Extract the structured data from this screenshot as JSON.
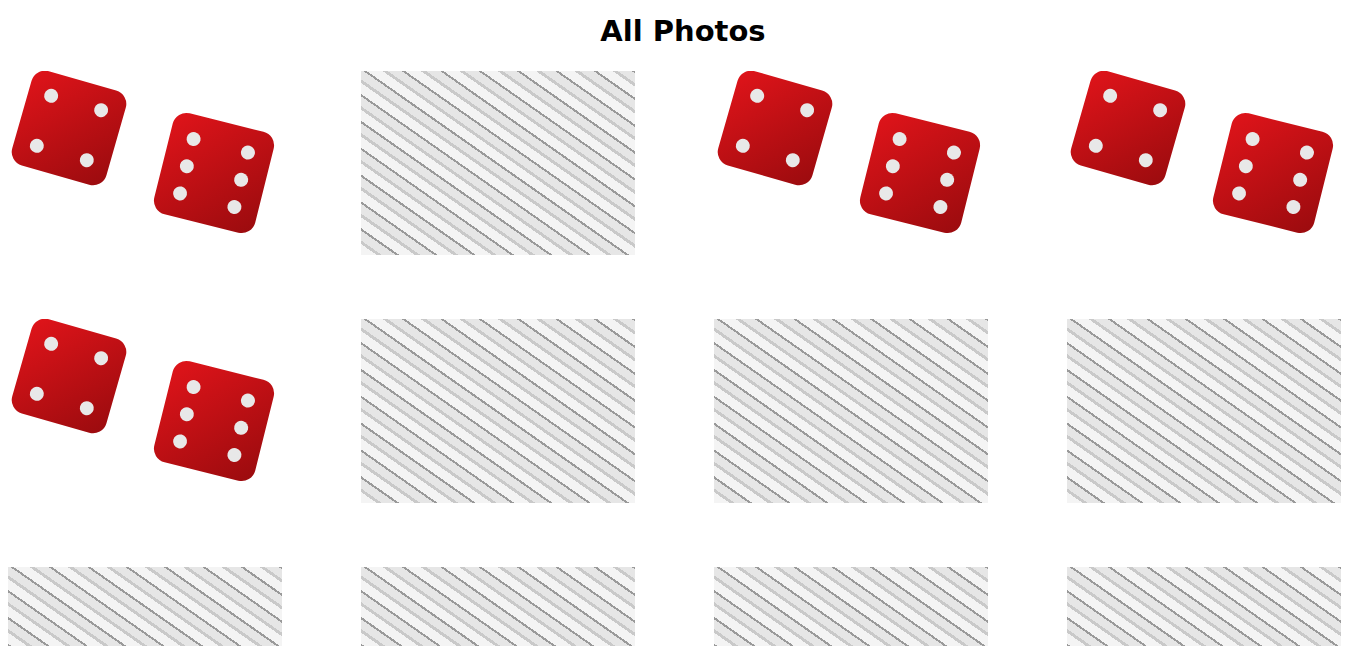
{
  "page": {
    "title": "All Photos"
  },
  "photos": [
    {
      "kind": "dice"
    },
    {
      "kind": "numbers"
    },
    {
      "kind": "dice"
    },
    {
      "kind": "dice"
    },
    {
      "kind": "dice"
    },
    {
      "kind": "numbers"
    },
    {
      "kind": "numbers"
    },
    {
      "kind": "numbers"
    },
    {
      "kind": "numbers"
    },
    {
      "kind": "numbers"
    },
    {
      "kind": "numbers"
    },
    {
      "kind": "numbers"
    }
  ]
}
